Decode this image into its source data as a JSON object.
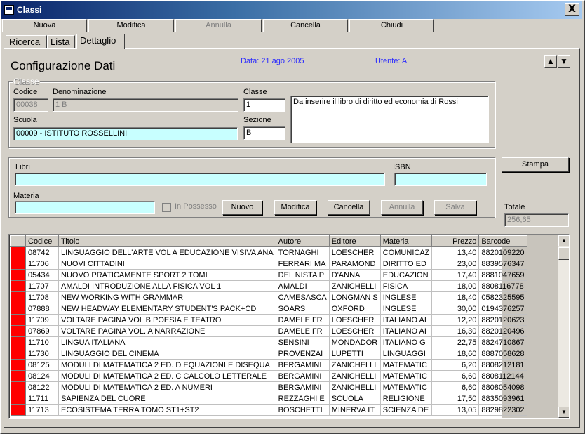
{
  "window": {
    "title": "Classi",
    "close": "X"
  },
  "toolbar": {
    "nuova": "Nuova",
    "modifica": "Modifica",
    "annulla": "Annulla",
    "cancella": "Cancella",
    "chiudi": "Chiudi"
  },
  "tabs": {
    "ricerca": "Ricerca",
    "lista": "Lista",
    "dettaglio": "Dettaglio"
  },
  "header": {
    "title": "Configurazione Dati",
    "data": "Data: 21 ago 2005",
    "utente": "Utente: A"
  },
  "classe": {
    "legend": "Classe",
    "codice_label": "Codice",
    "codice": "00038",
    "denominazione_label": "Denominazione",
    "denominazione": "1 B",
    "classe_label": "Classe",
    "classe": "1",
    "scuola_label": "Scuola",
    "scuola": "00009 - ISTITUTO ROSSELLINI",
    "sezione_label": "Sezione",
    "sezione": "B",
    "note": "Da inserire il libro di diritto ed economia di Rossi"
  },
  "libri": {
    "libri_label": "Libri",
    "libri": "",
    "isbn_label": "ISBN",
    "isbn": "",
    "materia_label": "Materia",
    "materia": "",
    "in_possesso": "In Possesso",
    "nuovo": "Nuovo",
    "modifica": "Modifica",
    "cancella": "Cancella",
    "annulla": "Annulla",
    "salva": "Salva"
  },
  "side": {
    "stampa": "Stampa",
    "totale_label": "Totale",
    "totale": "256,65"
  },
  "grid": {
    "columns": [
      "Codice",
      "Titolo",
      "Autore",
      "Editore",
      "Materia",
      "Prezzo",
      "Barcode"
    ],
    "rows": [
      [
        "08742",
        "LINGUAGGIO DELL'ARTE VOL A EDUCAZIONE VISIVA ANA",
        "TORNAGHI",
        "LOESCHER",
        "COMUNICAZ",
        "13,40",
        "8820109220"
      ],
      [
        "11706",
        "NUOVI CITTADINI",
        "FERRARI MA",
        "PARAMOND",
        "DIRITTO ED",
        "23,00",
        "8839576347"
      ],
      [
        "05434",
        "NUOVO PRATICAMENTE SPORT 2 TOMI",
        "DEL NISTA P",
        "D'ANNA",
        "EDUCAZION",
        "17,40",
        "8881047659"
      ],
      [
        "11707",
        "AMALDI INTRODUZIONE ALLA FISICA VOL 1",
        "AMALDI",
        "ZANICHELLI",
        "FISICA",
        "18,00",
        "8808116778"
      ],
      [
        "11708",
        "NEW WORKING WITH GRAMMAR",
        "CAMESASCA",
        "LONGMAN S",
        "INGLESE",
        "18,40",
        "0582325595"
      ],
      [
        "07888",
        "NEW HEADWAY ELEMENTARY STUDENT'S PACK+CD",
        "SOARS",
        "OXFORD",
        "INGLESE",
        "30,00",
        "0194376257"
      ],
      [
        "11709",
        "VOLTARE PAGINA VOL B POESIA E TEATRO",
        "DAMELE FR",
        "LOESCHER",
        "ITALIANO AI",
        "12,20",
        "8820120623"
      ],
      [
        "07869",
        "VOLTARE PAGINA VOL. A NARRAZIONE",
        "DAMELE FR",
        "LOESCHER",
        "ITALIANO AI",
        "16,30",
        "8820120496"
      ],
      [
        "11710",
        "LINGUA ITALIANA",
        "SENSINI",
        "MONDADOR",
        "ITALIANO G",
        "22,75",
        "8824710867"
      ],
      [
        "11730",
        "LINGUAGGIO DEL CINEMA",
        "PROVENZAI",
        "LUPETTI",
        "LINGUAGGI",
        "18,60",
        "8887058628"
      ],
      [
        "08125",
        "MODULI DI MATEMATICA 2 ED. D EQUAZIONI E DISEQUA",
        "BERGAMINI",
        "ZANICHELLI",
        "MATEMATIC",
        "6,20",
        "8808212181"
      ],
      [
        "08124",
        "MODULI DI MATEMATICA 2 ED. C CALCOLO LETTERALE",
        "BERGAMINI",
        "ZANICHELLI",
        "MATEMATIC",
        "6,60",
        "8808112144"
      ],
      [
        "08122",
        "MODULI DI MATEMATICA 2 ED. A NUMERI",
        "BERGAMINI",
        "ZANICHELLI",
        "MATEMATIC",
        "6,60",
        "8808054098"
      ],
      [
        "11711",
        "SAPIENZA DEL CUORE",
        "REZZAGHI E",
        "SCUOLA",
        "RELIGIONE",
        "17,50",
        "8835093961"
      ],
      [
        "11713",
        "ECOSISTEMA TERRA TOMO ST1+ST2",
        "BOSCHETTI",
        "MINERVA IT",
        "SCIENZA DE",
        "13,05",
        "8829822302"
      ]
    ]
  },
  "colors": {
    "marker": "#ff0000",
    "field_cyan": "#c8ffff",
    "title_blue": "#2a2aff"
  }
}
